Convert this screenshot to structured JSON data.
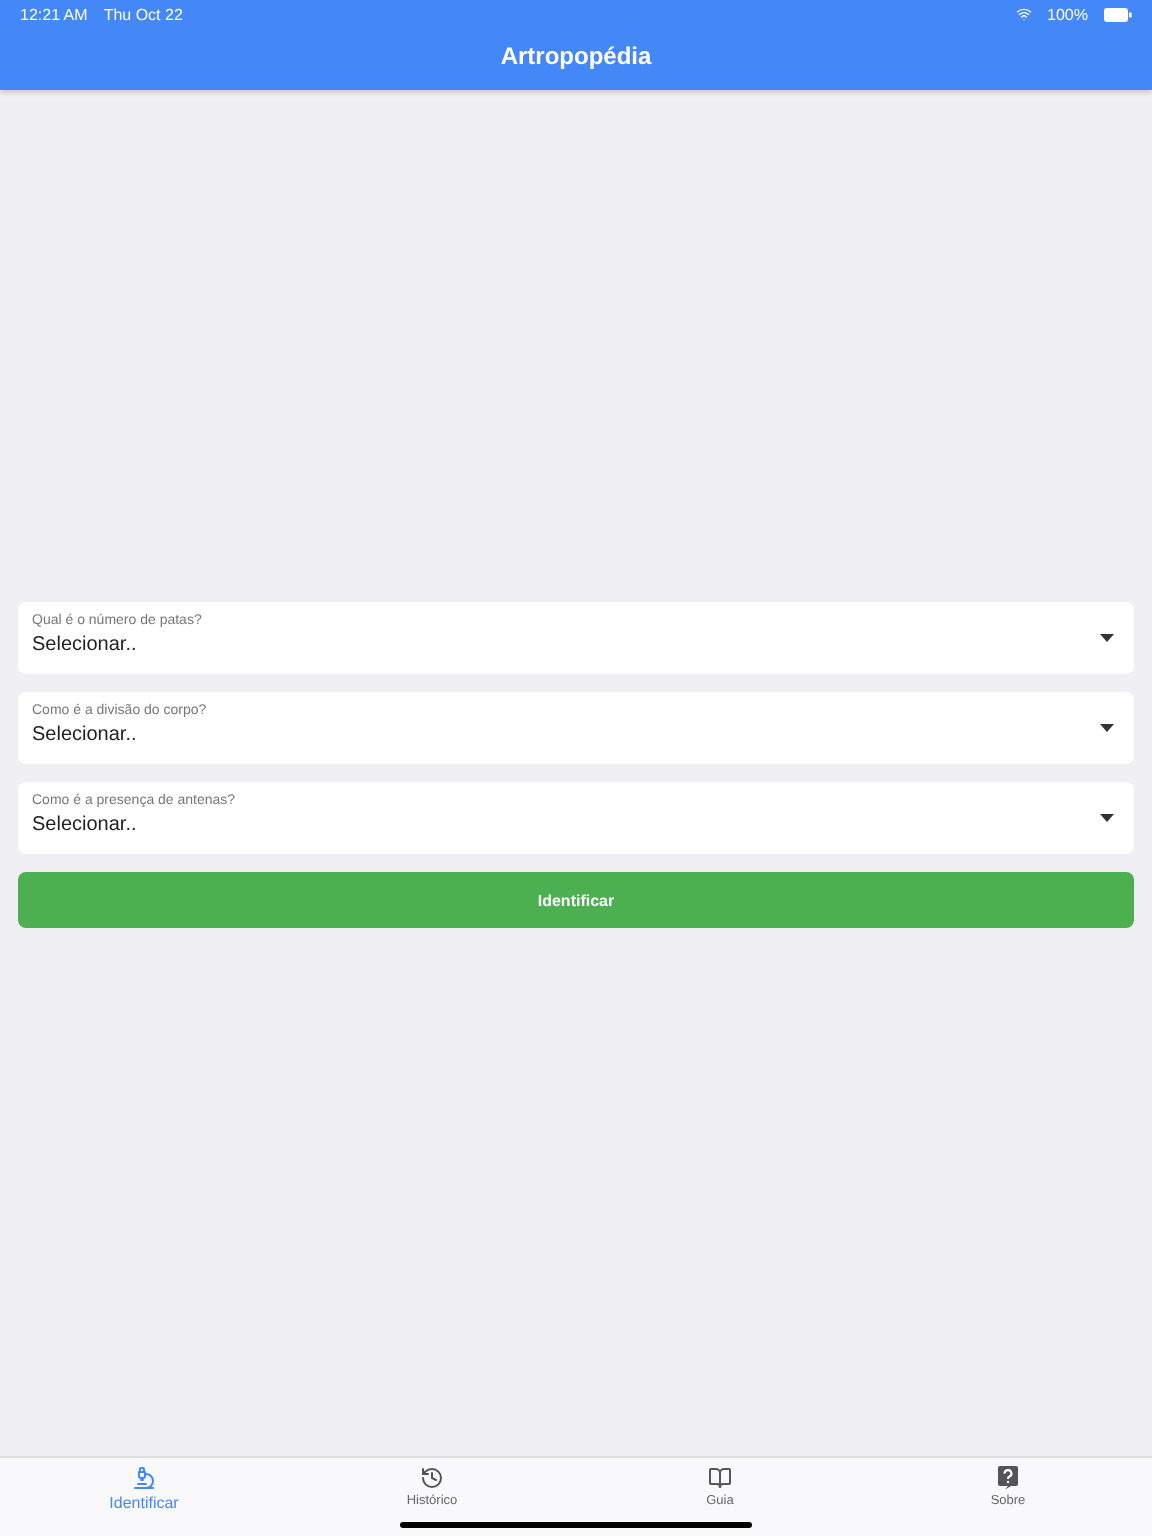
{
  "status_bar": {
    "time": "12:21 AM",
    "date": "Thu Oct 22",
    "battery": "100%"
  },
  "header": {
    "title": "Artropopédia"
  },
  "selects": [
    {
      "label": "Qual é o número de patas?",
      "value": "Selecionar.."
    },
    {
      "label": "Como é a divisão do corpo?",
      "value": "Selecionar.."
    },
    {
      "label": "Como é a presença de antenas?",
      "value": "Selecionar.."
    }
  ],
  "submit": {
    "label": "Identificar"
  },
  "tabs": [
    {
      "label": "Identificar",
      "selected": true
    },
    {
      "label": "Histórico",
      "selected": false
    },
    {
      "label": "Guia",
      "selected": false
    },
    {
      "label": "Sobre",
      "selected": false
    }
  ]
}
